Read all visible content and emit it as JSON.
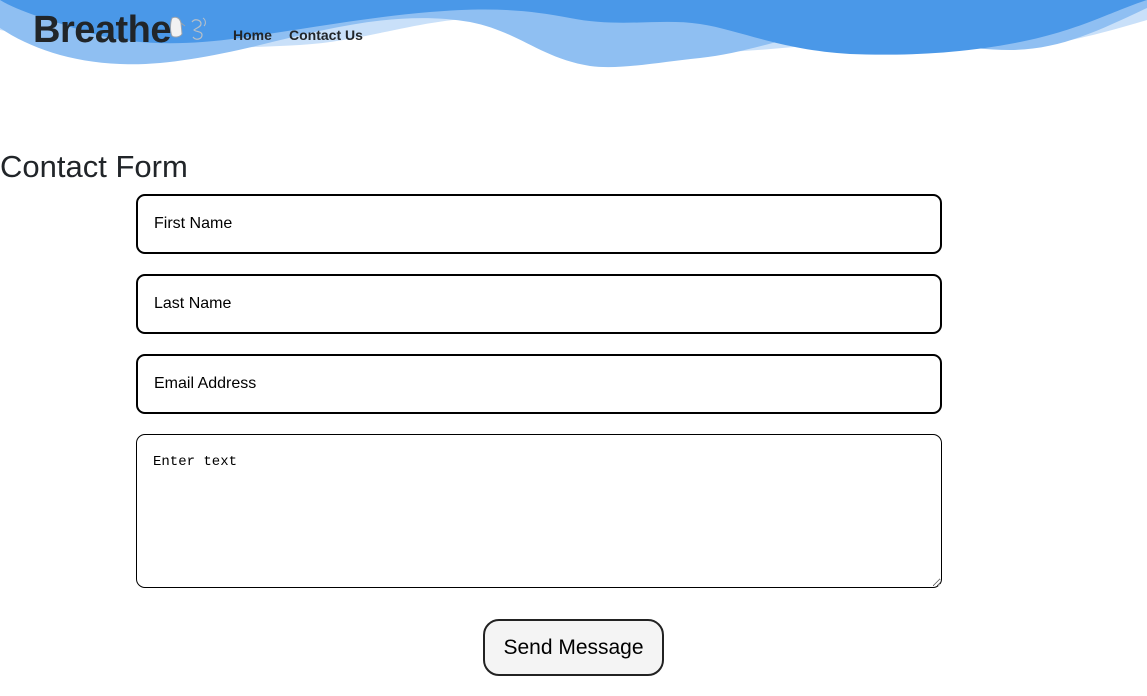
{
  "navbar": {
    "brand": "Breathe",
    "logo_icon": "lungs-logo-icon",
    "links": [
      {
        "label": "Home"
      },
      {
        "label": "Contact Us"
      }
    ]
  },
  "theme": {
    "wave_dark": "#4a98e8",
    "wave_mid": "#8fbff2",
    "wave_light": "#c9e0f9"
  },
  "form": {
    "title": "Contact Form",
    "first_name_placeholder": "First Name",
    "last_name_placeholder": "Last Name",
    "email_placeholder": "Email Address",
    "message_placeholder": "Enter text",
    "submit_label": "Send Message"
  }
}
